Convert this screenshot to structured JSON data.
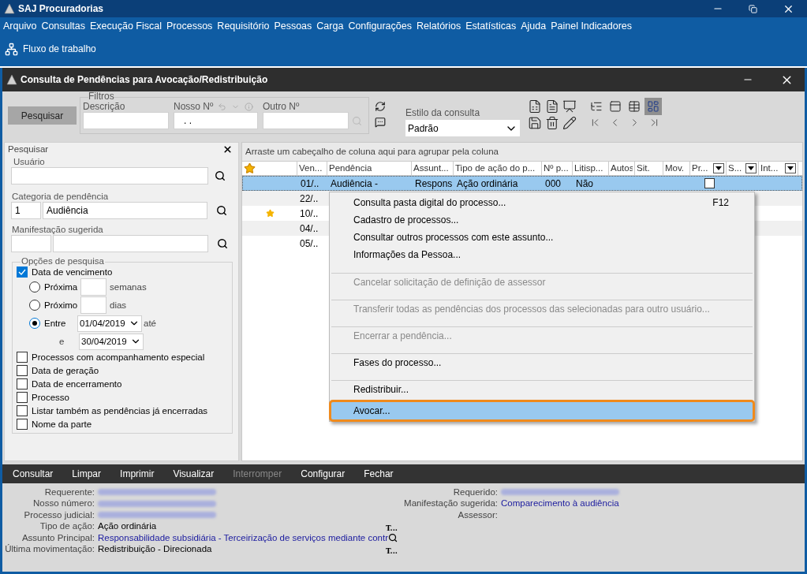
{
  "app": {
    "title": "SAJ Procuradorias"
  },
  "menu_bar": [
    "Arquivo",
    "Consultas",
    "Execução Fiscal",
    "Processos",
    "Requisitório",
    "Pessoas",
    "Carga",
    "Configurações",
    "Relatórios",
    "Estatísticas",
    "Ajuda",
    "Painel Indicadores"
  ],
  "toolbar": [
    {
      "label": "Fluxo de trabalho"
    }
  ],
  "window": {
    "title": "Consulta de Pendências para Avocação/Redistribuição"
  },
  "search_button": "Pesquisar",
  "filters": {
    "legend": "Filtros",
    "description": {
      "label": "Descrição"
    },
    "our_number": {
      "label": "Nosso Nº",
      "value": ". ."
    },
    "other_number": {
      "label": "Outro Nº"
    }
  },
  "query_style": {
    "label": "Estilo da consulta",
    "value": "Padrão"
  },
  "view_buttons": [
    {
      "selected": false
    },
    {
      "selected": false
    },
    {
      "selected": false
    },
    {
      "selected": true
    }
  ],
  "side_panel": {
    "title": "Pesquisar",
    "user": {
      "label": "Usuário"
    },
    "category": {
      "label": "Categoria de pendência",
      "code": "1",
      "name": "Audiência"
    },
    "suggested": {
      "label": "Manifestação sugerida"
    },
    "options": {
      "legend": "Opções de pesquisa",
      "due_date": {
        "label": "Data de vencimento",
        "checked": true
      },
      "radios": [
        {
          "kind": "count",
          "label": "Próxima",
          "unit": "semanas",
          "selected": false
        },
        {
          "kind": "count",
          "label": "Próximo",
          "unit": "dias",
          "selected": false
        },
        {
          "kind": "range",
          "label": "Entre",
          "from": "01/04/2019",
          "to_label": "até",
          "and_label": "e",
          "to": "30/04/2019",
          "selected": true
        }
      ],
      "checks": [
        {
          "label": "Processos com acompanhamento especial",
          "checked": false
        },
        {
          "label": "Data de geração",
          "checked": false
        },
        {
          "label": "Data de encerramento",
          "checked": false
        },
        {
          "label": "Processo",
          "checked": false
        },
        {
          "label": "Listar também as pendências já encerradas",
          "checked": false
        },
        {
          "label": "Nome da parte",
          "checked": false
        }
      ]
    }
  },
  "grid": {
    "group_hint": "Arraste um cabeçalho de coluna aqui para agrupar pela coluna",
    "columns": [
      {
        "label": "Ven...",
        "filter": false
      },
      {
        "label": "Pendência",
        "filter": false
      },
      {
        "label": "Assunt...",
        "filter": false
      },
      {
        "label": "Tipo de ação do p...",
        "filter": false
      },
      {
        "label": "Nº p...",
        "filter": false
      },
      {
        "label": "Litisp...",
        "filter": false
      },
      {
        "label": "Autos",
        "filter": false
      },
      {
        "label": "Sit.",
        "filter": false
      },
      {
        "label": "Mov.",
        "filter": false
      },
      {
        "label": "Pr...",
        "filter": true
      },
      {
        "label": "S...",
        "filter": true
      },
      {
        "label": "Int...",
        "filter": true
      }
    ],
    "rows": [
      {
        "selected": true,
        "starred": false,
        "cells": [
          "01/..",
          "Audiência -",
          "Respons",
          "Ação ordinária",
          "000",
          "Não"
        ],
        "flag_checked": false
      },
      {
        "selected": false,
        "starred": false,
        "cells": [
          "22/.."
        ]
      },
      {
        "selected": false,
        "starred": true,
        "cells": [
          "10/.."
        ]
      },
      {
        "selected": false,
        "starred": false,
        "cells": [
          "04/.."
        ]
      },
      {
        "selected": false,
        "starred": false,
        "cells": [
          "05/.."
        ]
      }
    ]
  },
  "context_menu": [
    {
      "label": "Consulta pasta digital do processo...",
      "shortcut": "F12",
      "disabled": false,
      "selected": false,
      "separator_before": false
    },
    {
      "label": "Cadastro de processos...",
      "disabled": false,
      "selected": false,
      "separator_before": false
    },
    {
      "label": "Consultar outros processos com este assunto...",
      "disabled": false,
      "selected": false,
      "separator_before": false
    },
    {
      "label": "Informações da Pessoa...",
      "disabled": false,
      "selected": false,
      "separator_before": false
    },
    {
      "label": "Cancelar solicitação de definição de assessor",
      "disabled": true,
      "selected": false,
      "separator_before": true
    },
    {
      "label": "Transferir todas as pendências dos processos das selecionadas para outro usuário...",
      "disabled": true,
      "selected": false,
      "separator_before": true
    },
    {
      "label": "Encerrar a pendência...",
      "disabled": true,
      "selected": false,
      "separator_before": true
    },
    {
      "label": "Fases do processo...",
      "disabled": false,
      "selected": false,
      "separator_before": true
    },
    {
      "label": "Redistribuir...",
      "disabled": false,
      "selected": false,
      "separator_before": true
    },
    {
      "label": "Avocar...",
      "disabled": false,
      "selected": true,
      "separator_before": false
    }
  ],
  "actions": [
    {
      "label": "Consultar",
      "disabled": false
    },
    {
      "label": "Limpar",
      "disabled": false
    },
    {
      "label": "Imprimir",
      "disabled": false
    },
    {
      "label": "Visualizar",
      "disabled": false
    },
    {
      "label": "Interromper",
      "disabled": true
    },
    {
      "label": "Configurar",
      "disabled": false
    },
    {
      "label": "Fechar",
      "disabled": false
    }
  ],
  "details": {
    "left": [
      {
        "label": "Requerente:",
        "kind": "redacted"
      },
      {
        "label": "Nosso número:",
        "kind": "redacted"
      },
      {
        "label": "Processo judicial:",
        "kind": "redacted"
      },
      {
        "label": "Tipo de ação:",
        "kind": "text",
        "value": "Ação ordinária",
        "suffix": "T..."
      },
      {
        "label": "Assunto Principal:",
        "kind": "link",
        "value": "Responsabilidade subsidiária - Terceirização de serviços mediante contr",
        "lookup": true
      },
      {
        "label": "Última movimentação:",
        "kind": "text",
        "value": "Redistribuição - Direcionada",
        "suffix": "T..."
      }
    ],
    "right": [
      {
        "label": "Requerido:",
        "kind": "redacted"
      },
      {
        "label": "Manifestação sugerida:",
        "kind": "link",
        "value": "Comparecimento à audiência"
      },
      {
        "label": "Assessor:",
        "kind": "empty"
      }
    ]
  }
}
